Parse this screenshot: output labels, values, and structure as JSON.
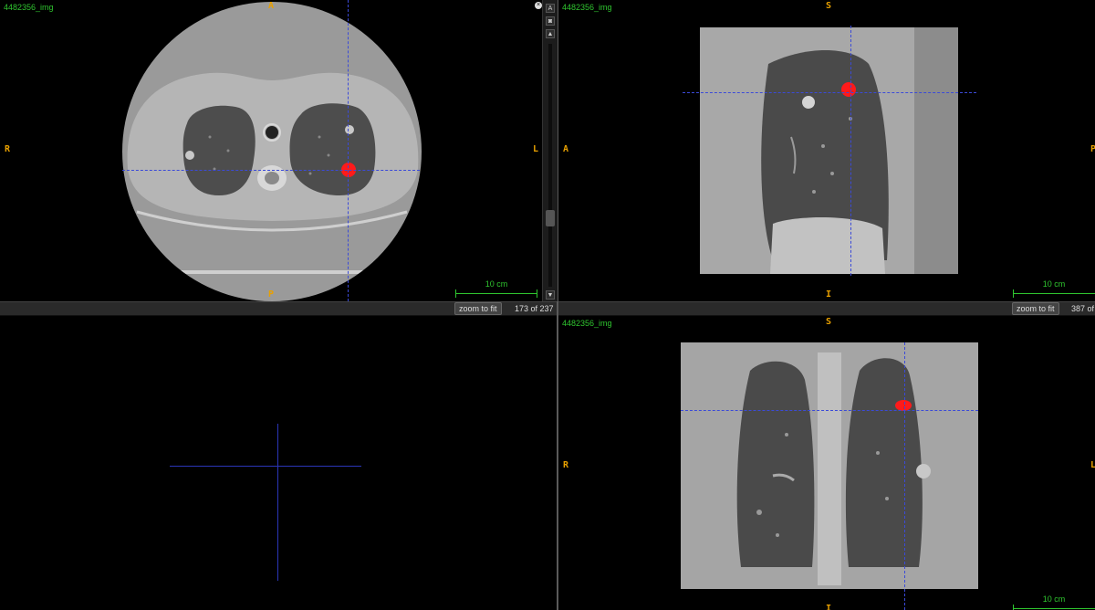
{
  "volume_label": "4482356_img",
  "axial": {
    "top": "A",
    "bottom": "P",
    "left": "R",
    "right": "L",
    "scale": "10 cm",
    "zoom_label": "zoom to fit",
    "slice": "173 of 237"
  },
  "sagittal": {
    "top": "S",
    "bottom": "I",
    "left": "A",
    "right": "P",
    "scale": "10 cm",
    "zoom_label": "zoom to fit",
    "slice": "387 of"
  },
  "coronal": {
    "top": "S",
    "bottom": "I",
    "left": "R",
    "right": "L",
    "scale": "10 cm"
  },
  "sidebar": {
    "close": "×",
    "a_button": "A",
    "camera": "◙",
    "up": "▲",
    "down": "▼"
  },
  "colors": {
    "orientation": "#e8a000",
    "label": "#2fc52f",
    "crosshair": "#3b4ad8",
    "lesion": "#ff1a1a"
  }
}
